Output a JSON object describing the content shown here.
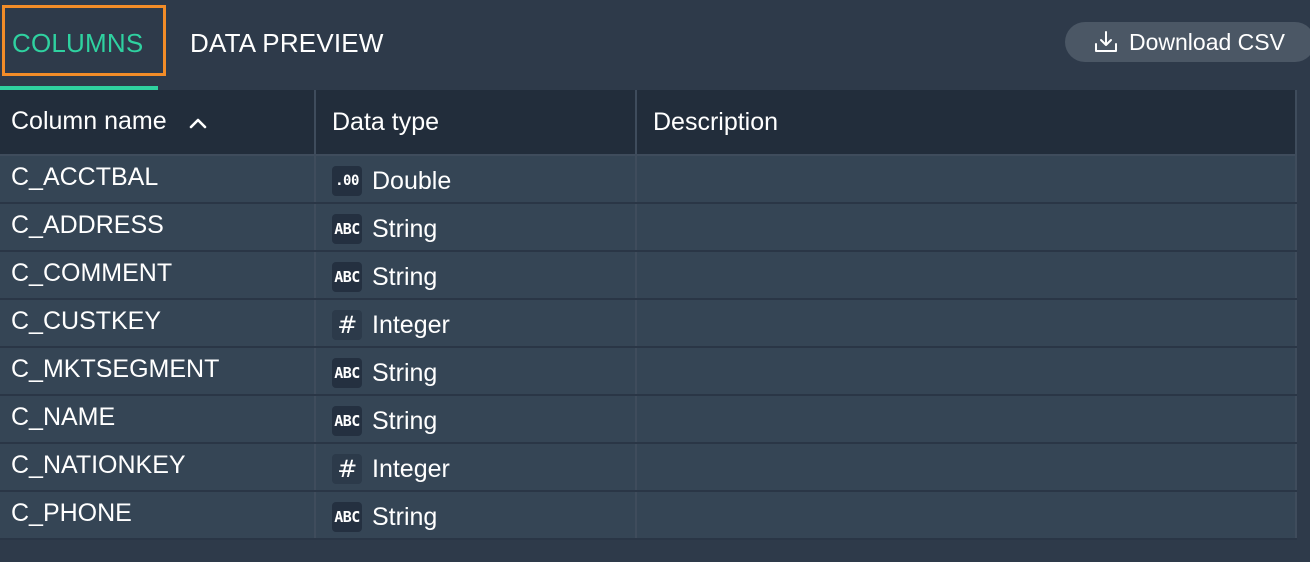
{
  "tabs": {
    "columns_label": "COLUMNS",
    "preview_label": "DATA PREVIEW"
  },
  "toolbar": {
    "download_label": "Download CSV"
  },
  "table": {
    "headers": [
      "Column name",
      "Data type",
      "Description"
    ],
    "sorted_by": "Column name",
    "sort_direction": "ascending",
    "rows": [
      {
        "name": "C_ACCTBAL",
        "type_icon": ".00",
        "type": "Double",
        "description": ""
      },
      {
        "name": "C_ADDRESS",
        "type_icon": "ABC",
        "type": "String",
        "description": ""
      },
      {
        "name": "C_COMMENT",
        "type_icon": "ABC",
        "type": "String",
        "description": ""
      },
      {
        "name": "C_CUSTKEY",
        "type_icon": "#",
        "type": "Integer",
        "description": ""
      },
      {
        "name": "C_MKTSEGMENT",
        "type_icon": "ABC",
        "type": "String",
        "description": ""
      },
      {
        "name": "C_NAME",
        "type_icon": "ABC",
        "type": "String",
        "description": ""
      },
      {
        "name": "C_NATIONKEY",
        "type_icon": "#",
        "type": "Integer",
        "description": ""
      },
      {
        "name": "C_PHONE",
        "type_icon": "ABC",
        "type": "String",
        "description": ""
      }
    ]
  },
  "colors": {
    "accent": "#2fd1a0",
    "highlight": "#f28c28",
    "background": "#2e3a4a",
    "header_bg": "#222d3b",
    "row_bg": "#354555"
  }
}
